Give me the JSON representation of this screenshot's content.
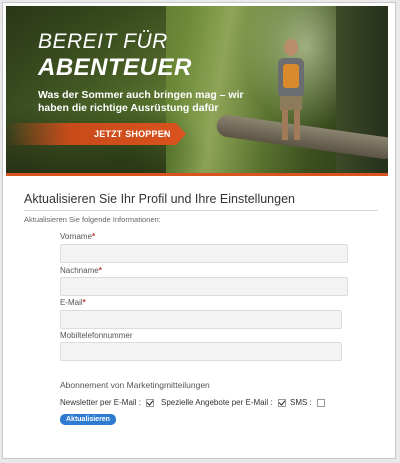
{
  "banner": {
    "headline_line1": "BEREIT FÜR",
    "headline_line2": "ABENTEUER",
    "subtext": "Was der Sommer auch bringen mag – wir haben die richtige Ausrüstung dafür",
    "cta_label": "JETZT SHOPPEN",
    "cta_arrow": "→",
    "accent_color": "#d9531e"
  },
  "form": {
    "title": "Aktualisieren Sie Ihr Profil und Ihre Einstellungen",
    "intro": "Aktualisieren Sie folgende Informationen:",
    "required_marker": "*",
    "fields": [
      {
        "label": "Vorname",
        "required": true,
        "value": ""
      },
      {
        "label": "Nachname",
        "required": true,
        "value": ""
      },
      {
        "label": "E-Mail",
        "required": true,
        "value": ""
      },
      {
        "label": "Mobiltelefonnummer",
        "required": false,
        "value": ""
      }
    ],
    "subscriptions": {
      "title": "Abonnement von Marketingmitteilungen",
      "options": [
        {
          "label": "Newsletter per E-Mail :",
          "checked": true
        },
        {
          "label": "Spezielle Angebote per E-Mail :",
          "checked": true
        },
        {
          "label": "SMS :",
          "checked": false
        }
      ]
    },
    "submit_label": "Aktualisieren",
    "submit_color": "#2e7bd1"
  }
}
